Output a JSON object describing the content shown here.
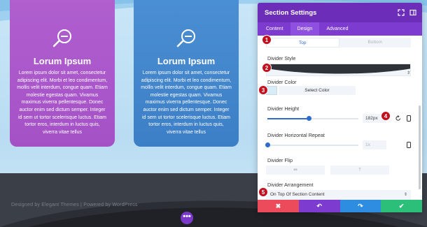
{
  "colors": {
    "accent": "#7e3bd0",
    "panel_header": "#6c2eb9",
    "marker": "#c40f1e"
  },
  "cards": [
    {
      "title": "Lorum Ipsum",
      "text": "Lorem ipsum dolor sit amet, consectetur adipiscing elit. Morbi et leo condimentum, mollis velit interdum, congue quam. Etiam molestie egestas quam. Vivamus maximus viverra pellentesque. Donec auctor enim sed dictum semper. Integer id sem ut tortor scelerisque luctus. Etiam tortor eros, interdum in luctus quis, viverra vitae tellus",
      "icon": "search-icon",
      "color": "#a451c6"
    },
    {
      "title": "Lorum Ipsum",
      "text": "Lorem ipsum dolor sit amet, consectetur adipiscing elit. Morbi et leo condimentum, mollis velit interdum, congue quam. Etiam molestie egestas quam. Vivamus maximus viverra pellentesque. Donec auctor enim sed dictum semper. Integer id sem ut tortor scelerisque luctus. Etiam tortor eros, interdum in luctus quis, viverra vitae tellus",
      "icon": "search-icon",
      "color": "#3c7fc6"
    }
  ],
  "footer": {
    "credits": "Designed by Elegant Themes | Powered by WordPress"
  },
  "panel": {
    "title": "Section Settings",
    "tabs": [
      "Content",
      "Design",
      "Advanced"
    ],
    "active_tab": "Design",
    "position_options": [
      "Top",
      "Bottom"
    ],
    "selected_position": "Top",
    "divider_style_label": "Divider Style",
    "divider_color_label": "Divider Color",
    "select_color_label": "Select Color",
    "divider_height_label": "Divider Height",
    "divider_height_value": "182px",
    "divider_height_level": 0.45,
    "divider_repeat_label": "Divider Horizontal Repeat",
    "divider_repeat_value": "1x",
    "divider_repeat_level": 0.0,
    "divider_flip_label": "Divider Flip",
    "flip_horizontal_symbol": "⇹",
    "flip_vertical_symbol": "⤒",
    "divider_arrangement_label": "Divider Arrangement",
    "divider_arrangement_value": "On Top Of Section Content"
  },
  "footer_buttons": {
    "cancel": "✖",
    "undo": "↶",
    "redo": "↷",
    "save": "✔"
  },
  "markers": [
    "1",
    "2",
    "3",
    "4",
    "5"
  ],
  "more_button": "•••"
}
